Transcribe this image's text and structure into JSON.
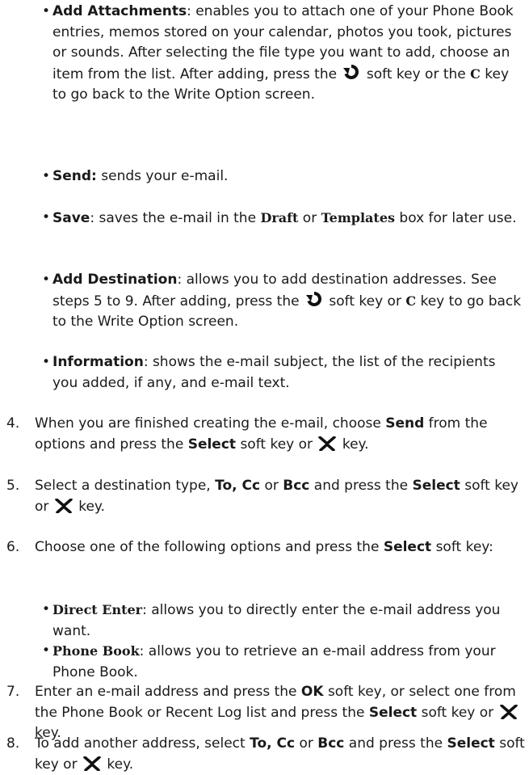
{
  "bullets": {
    "attach": {
      "term": "Add Attachments",
      "t1": ": enables you to attach one of your Phone Book entries, memos stored on your calendar, photos you took, pictures or sounds. After selecting the file type you want to add, choose an item from the list. After adding, press the ",
      "t2": " soft key or the ",
      "key_c": "C",
      "t3": " key to go back to the Write Option screen."
    },
    "send": {
      "term": "Send:",
      "t1": " sends your e-mail."
    },
    "save": {
      "term": "Save",
      "t1": ": saves the e-mail in the ",
      "draft": "Draft",
      "t2": " or ",
      "templates": "Templates",
      "t3": " box for later use."
    },
    "dest": {
      "term": "Add Destination",
      "t1": ": allows you to add destination addresses. See steps 5 to 9. After adding, press the ",
      "t2": " soft key or ",
      "key_c": "C",
      "t3": " key to go back to the Write Option screen."
    },
    "info": {
      "term": "Information",
      "t1": ": shows the e-mail subject, the list of the recipients you added, if any, and e-mail text."
    }
  },
  "steps": {
    "s4": {
      "num": "4.",
      "t1": "When you are finished creating the e-mail, choose ",
      "b1": "Send",
      "t2": " from the options and press the ",
      "b2": "Select",
      "t3": " soft key  or ",
      "t4": " key."
    },
    "s5": {
      "num": "5.",
      "t1": "Select a destination type, ",
      "b1": "To, Cc",
      "t2": " or ",
      "b2": "Bcc",
      "t3": " and press the ",
      "b3": "Select",
      "t4": " soft key or ",
      "t5": " key."
    },
    "s6": {
      "num": "6.",
      "t1": "Choose one of the following options and press the ",
      "b1": "Select",
      "t2": " soft key:"
    },
    "s7": {
      "num": "7.",
      "t1": "Enter an e-mail address and press the ",
      "b1": "OK",
      "t2": " soft key, or select one from the Phone Book or Recent Log list and press the ",
      "b2": "Select",
      "t3": " soft key or ",
      "t4": " key."
    },
    "s8": {
      "num": "8.",
      "t1": "To add another address, select ",
      "b1": "To, Cc",
      "t2": " or ",
      "b2": "Bcc",
      "t3": " and press the ",
      "b3": "Select",
      "t4": " soft key or ",
      "t5": " key."
    }
  },
  "sub_options": {
    "direct": {
      "term": "Direct Enter",
      "t1": ": allows you to directly enter the e-mail address you want."
    },
    "book": {
      "term": "Phone Book",
      "t1": ": allows you to retrieve an e-mail address from your Phone Book."
    }
  },
  "bullet_char": "•",
  "icons": {
    "back": "back-arrow-icon",
    "nav": "nav-key-icon"
  }
}
